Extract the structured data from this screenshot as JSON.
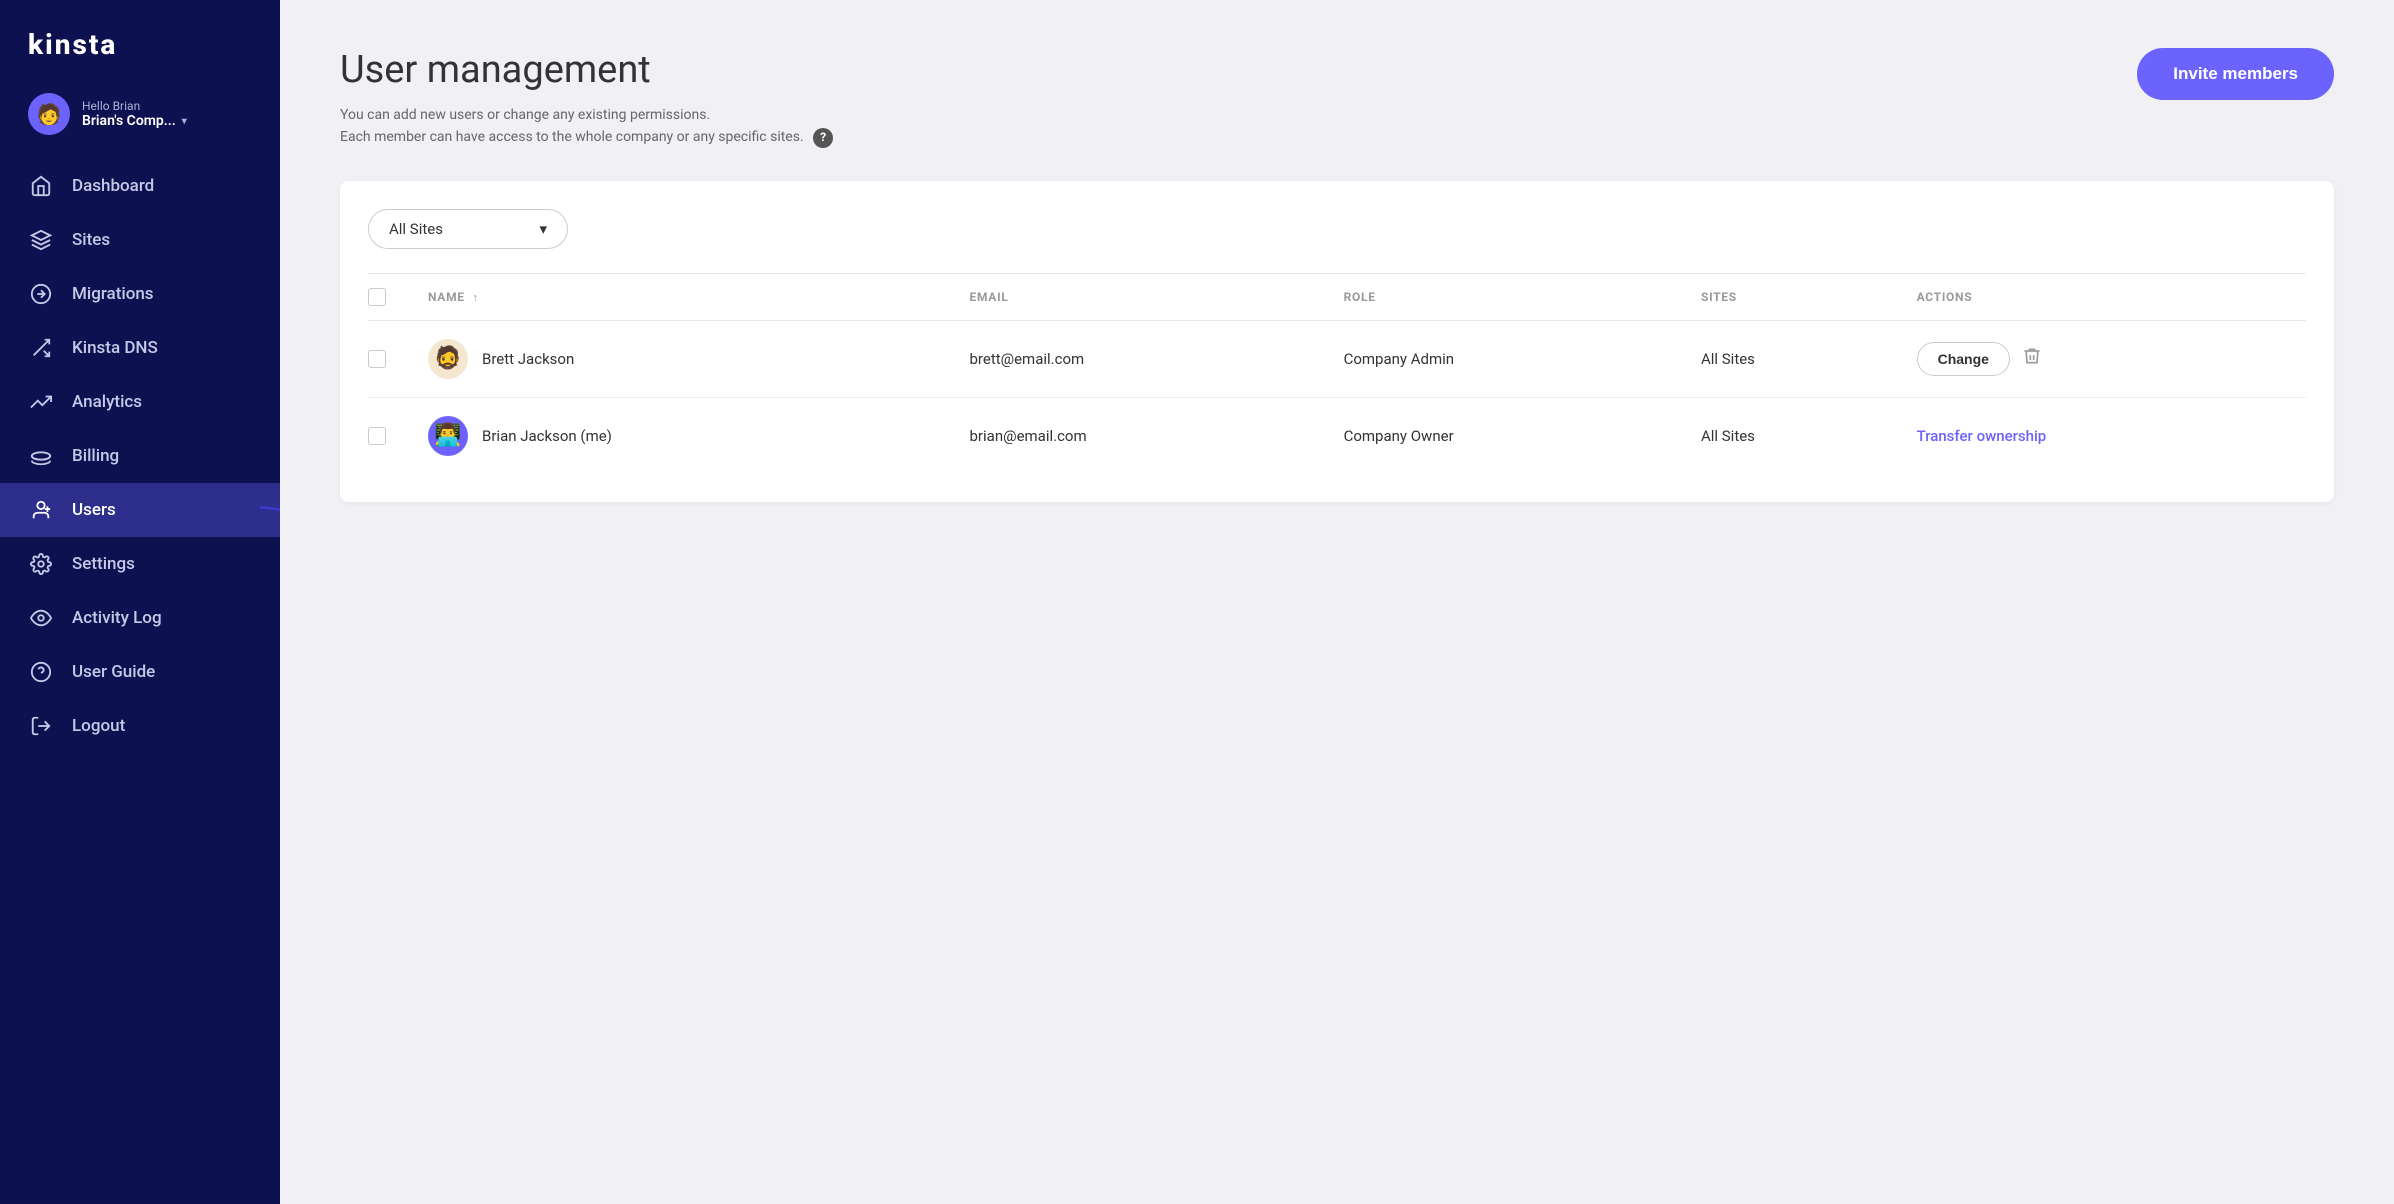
{
  "sidebar": {
    "logo": "kinsta",
    "user": {
      "greeting": "Hello Brian",
      "company": "Brian's Comp...",
      "avatar_emoji": "🧑"
    },
    "nav_items": [
      {
        "id": "dashboard",
        "label": "Dashboard",
        "icon": "home"
      },
      {
        "id": "sites",
        "label": "Sites",
        "icon": "layers"
      },
      {
        "id": "migrations",
        "label": "Migrations",
        "icon": "arrow-right-circle"
      },
      {
        "id": "kinsta-dns",
        "label": "Kinsta DNS",
        "icon": "shuffle"
      },
      {
        "id": "analytics",
        "label": "Analytics",
        "icon": "trending-up"
      },
      {
        "id": "billing",
        "label": "Billing",
        "icon": "credit-card"
      },
      {
        "id": "users",
        "label": "Users",
        "icon": "user-plus",
        "active": true
      },
      {
        "id": "settings",
        "label": "Settings",
        "icon": "settings"
      },
      {
        "id": "activity-log",
        "label": "Activity Log",
        "icon": "eye"
      },
      {
        "id": "user-guide",
        "label": "User Guide",
        "icon": "help-circle"
      },
      {
        "id": "logout",
        "label": "Logout",
        "icon": "log-out"
      }
    ]
  },
  "page": {
    "title": "User management",
    "description_line1": "You can add new users or change any existing permissions.",
    "description_line2": "Each member can have access to the whole company or any specific sites.",
    "invite_button": "Invite members"
  },
  "filter": {
    "sites_label": "All Sites",
    "chevron": "▾"
  },
  "table": {
    "columns": [
      {
        "id": "checkbox",
        "label": ""
      },
      {
        "id": "name",
        "label": "NAME",
        "sort": "↑"
      },
      {
        "id": "email",
        "label": "EMAIL"
      },
      {
        "id": "role",
        "label": "ROLE"
      },
      {
        "id": "sites",
        "label": "SITES"
      },
      {
        "id": "actions",
        "label": "ACTIONS"
      }
    ],
    "rows": [
      {
        "id": "brett",
        "name": "Brett Jackson",
        "email": "brett@email.com",
        "role": "Company Admin",
        "sites": "All Sites",
        "action_type": "change",
        "action_label": "Change",
        "avatar": "🧔"
      },
      {
        "id": "brian",
        "name": "Brian Jackson (me)",
        "email": "brian@email.com",
        "role": "Company Owner",
        "sites": "All Sites",
        "action_type": "transfer",
        "action_label": "Transfer ownership",
        "avatar": "👨‍💻"
      }
    ]
  }
}
